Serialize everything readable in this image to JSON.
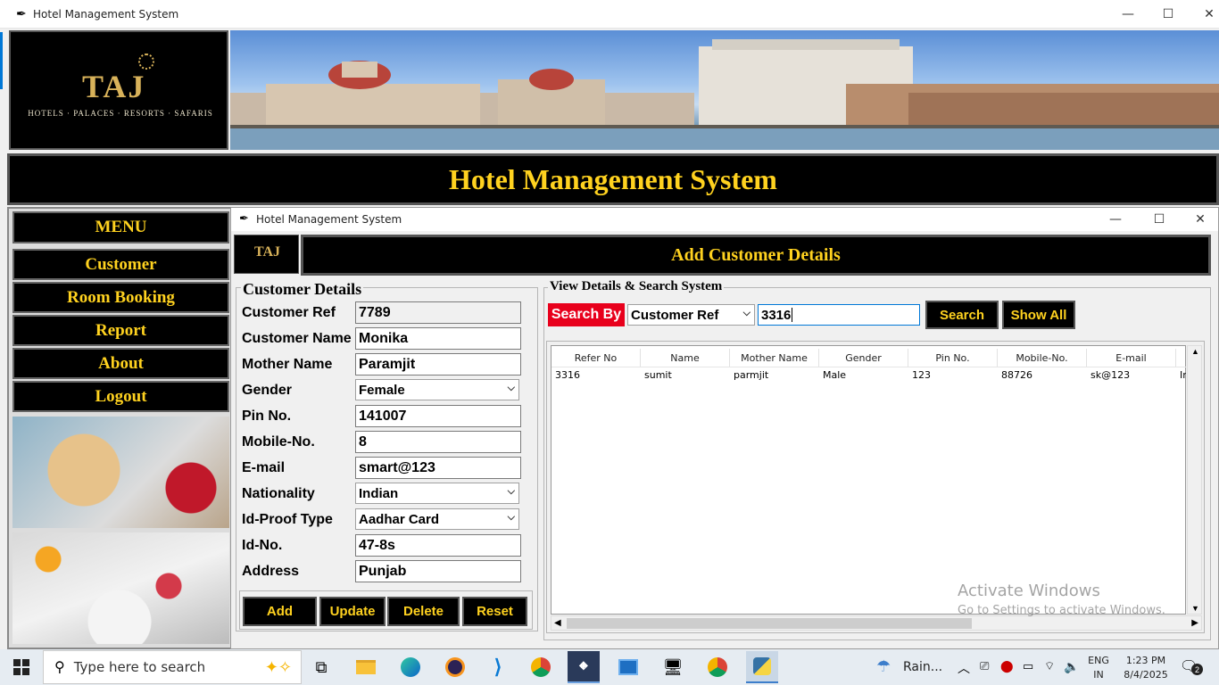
{
  "main_window": {
    "title": "Hotel Management System"
  },
  "header": {
    "logo_text": "TAJ",
    "logo_tagline": "HOTELS · PALACES · RESORTS · SAFARIS",
    "system_title": "Hotel Management System"
  },
  "sidebar": {
    "menu_title": "MENU",
    "items": [
      {
        "label": "Customer"
      },
      {
        "label": "Room Booking"
      },
      {
        "label": "Report"
      },
      {
        "label": "About"
      },
      {
        "label": "Logout"
      }
    ]
  },
  "customer_window": {
    "title": "Hotel Management System",
    "banner_title": "Add Customer Details",
    "details_section": {
      "title": "Customer Details",
      "fields": [
        {
          "label": "Customer Ref",
          "value": "7789"
        },
        {
          "label": "Customer Name",
          "value": "Monika"
        },
        {
          "label": "Mother Name",
          "value": "Paramjit"
        },
        {
          "label": "Gender",
          "value": "Female"
        },
        {
          "label": "Pin No.",
          "value": "141007"
        },
        {
          "label": "Mobile-No.",
          "value": "8"
        },
        {
          "label": "E-mail",
          "value": "smart@123"
        },
        {
          "label": "Nationality",
          "value": "Indian"
        },
        {
          "label": "Id-Proof Type",
          "value": "Aadhar Card"
        },
        {
          "label": "Id-No.",
          "value": "47-8s"
        },
        {
          "label": "Address",
          "value": "Punjab"
        }
      ],
      "buttons": {
        "add": "Add",
        "update": "Update",
        "delete": "Delete",
        "reset": "Reset"
      }
    },
    "search_section": {
      "title": "View Details & Search System",
      "search_by_label": "Search By",
      "search_by_selected": "Customer Ref",
      "search_value": "3316",
      "search_button": "Search",
      "show_all_button": "Show All",
      "table": {
        "columns": [
          "Refer No",
          "Name",
          "Mother Name",
          "Gender",
          "Pin No.",
          "Mobile-No.",
          "E-mail"
        ],
        "rows": [
          [
            "3316",
            "sumit",
            "parmjit",
            "Male",
            "123",
            "88726",
            "sk@123",
            "In"
          ]
        ]
      }
    }
  },
  "watermark": {
    "line1": "Activate Windows",
    "line2": "Go to Settings to activate Windows."
  },
  "taskbar": {
    "search_placeholder": "Type here to search",
    "weather": "Rain...",
    "language": "ENG",
    "region": "IN",
    "time": "1:23 PM",
    "date": "8/4/2025",
    "notification_count": "2"
  },
  "colors": {
    "accent_gold": "#ffd21f",
    "search_label_red": "#e8001c",
    "black": "#000000"
  }
}
